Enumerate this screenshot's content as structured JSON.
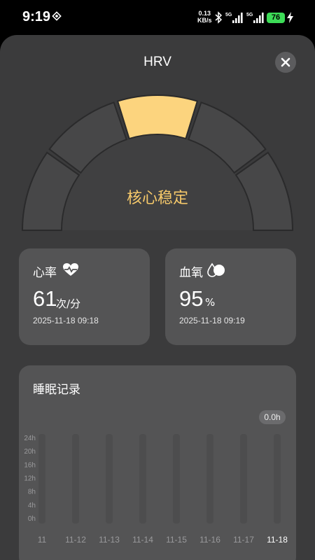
{
  "status_bar": {
    "time": "9:19",
    "net_speed_value": "0.13",
    "net_speed_unit": "KB/s",
    "signal_1_label": "5G",
    "signal_2_label": "5G",
    "battery": "76"
  },
  "sheet": {
    "title": "HRV",
    "close_icon": "close-icon"
  },
  "gauge": {
    "status_label": "核心稳定",
    "active_segment": 3,
    "segment_count": 5,
    "colors": {
      "active": "#fcd47e",
      "inactive": "#474748",
      "label": "#f6c96a"
    }
  },
  "heart_rate": {
    "title": "心率",
    "icon": "heart-pulse-icon",
    "value": "61",
    "unit": "次/分",
    "time": "2025-11-18 09:18"
  },
  "blood_oxygen": {
    "title": "血氧",
    "icon": "drops-icon",
    "value": "95",
    "unit": "%",
    "time": "2025-11-18 09:19"
  },
  "sleep": {
    "title": "睡眠记录",
    "badge": "0.0h",
    "chart_data": {
      "type": "bar",
      "title": "睡眠记录",
      "y_ticks": [
        "24h",
        "20h",
        "16h",
        "12h",
        "8h",
        "4h",
        "0h"
      ],
      "ylim": [
        0,
        24
      ],
      "categories": [
        "11",
        "11-12",
        "11-13",
        "11-14",
        "11-15",
        "11-16",
        "11-17",
        "11-18"
      ],
      "values": [
        0,
        0,
        0,
        0,
        0,
        0,
        0,
        0
      ],
      "highlighted_category": "11-18"
    }
  }
}
